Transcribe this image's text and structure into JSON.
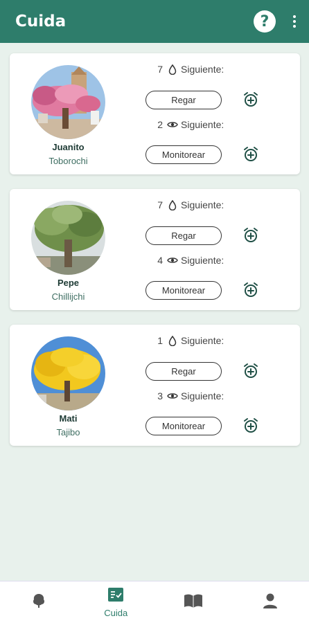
{
  "app": {
    "title": "Cuida",
    "help_label": "?"
  },
  "plants": [
    {
      "name": "Juanito",
      "species": "Toborochi",
      "photo": "pink-flowering-tree",
      "water": {
        "count": "7",
        "next_label": "Siguiente:",
        "button": "Regar"
      },
      "monitor": {
        "count": "2",
        "next_label": "Siguiente:",
        "button": "Monitorear"
      }
    },
    {
      "name": "Pepe",
      "species": "Chillijchi",
      "photo": "green-tree",
      "water": {
        "count": "7",
        "next_label": "Siguiente:",
        "button": "Regar"
      },
      "monitor": {
        "count": "4",
        "next_label": "Siguiente:",
        "button": "Monitorear"
      }
    },
    {
      "name": "Mati",
      "species": "Tajibo",
      "photo": "yellow-flowering-tree",
      "water": {
        "count": "1",
        "next_label": "Siguiente:",
        "button": "Regar"
      },
      "monitor": {
        "count": "3",
        "next_label": "Siguiente:",
        "button": "Monitorear"
      }
    }
  ],
  "icons": {
    "water": "water-drop-icon",
    "monitor": "eye-icon",
    "alarm": "alarm-add-icon"
  },
  "nav": {
    "items": [
      {
        "icon": "tree-icon",
        "label": ""
      },
      {
        "icon": "checklist-icon",
        "label": "Cuida"
      },
      {
        "icon": "book-icon",
        "label": ""
      },
      {
        "icon": "person-icon",
        "label": ""
      }
    ],
    "active_index": 1
  },
  "colors": {
    "primary": "#2e7d6b",
    "background": "#e8f1ec"
  }
}
